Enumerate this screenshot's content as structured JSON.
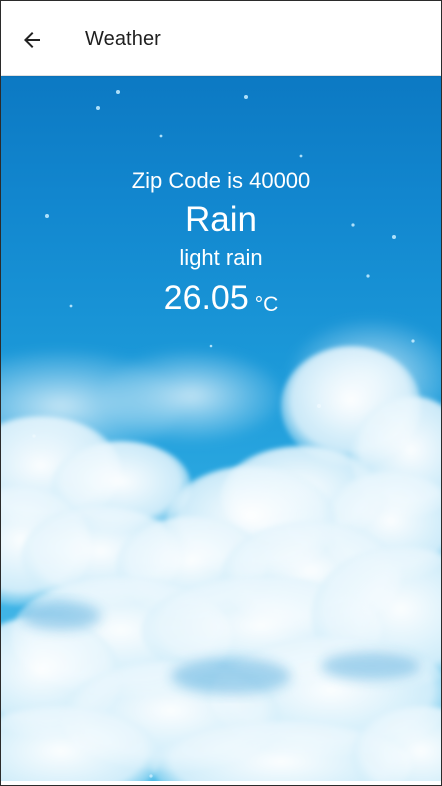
{
  "app_bar": {
    "title": "Weather",
    "back_icon": "arrow-left-icon"
  },
  "weather": {
    "zip_line": "Zip Code is 40000",
    "main": "Rain",
    "description": "light rain",
    "temperature": "26.05",
    "unit": "°C"
  },
  "background": {
    "image": "blue sky with clouds",
    "colors": {
      "sky_top": "#0c79c3",
      "sky_bottom": "#4cbbe8",
      "cloud": "#eaf7fd"
    }
  }
}
